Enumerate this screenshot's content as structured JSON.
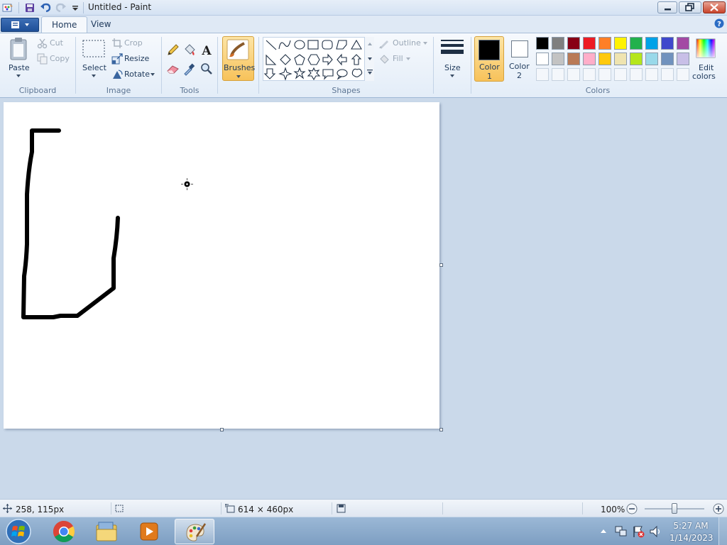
{
  "window": {
    "title": "Untitled - Paint"
  },
  "tabs": {
    "home": "Home",
    "view": "View"
  },
  "ribbon": {
    "clipboard": {
      "label": "Clipboard",
      "paste": "Paste",
      "cut": "Cut",
      "copy": "Copy"
    },
    "image": {
      "label": "Image",
      "select": "Select",
      "crop": "Crop",
      "resize": "Resize",
      "rotate": "Rotate"
    },
    "tools": {
      "label": "Tools"
    },
    "brushes": {
      "label": "Brushes"
    },
    "shapes": {
      "label": "Shapes",
      "outline": "Outline",
      "fill": "Fill"
    },
    "size": {
      "label": "Size"
    },
    "color1": {
      "label_line1": "Color",
      "label_line2": "1",
      "value": "#000000"
    },
    "color2": {
      "label_line1": "Color",
      "label_line2": "2",
      "value": "#ffffff"
    },
    "colors": {
      "label": "Colors",
      "edit_line1": "Edit",
      "edit_line2": "colors",
      "row1": [
        "#000000",
        "#7f7f7f",
        "#880015",
        "#ed1c24",
        "#ff7f27",
        "#fff200",
        "#22b14c",
        "#00a2e8",
        "#3f48cc",
        "#a349a4"
      ],
      "row2": [
        "#ffffff",
        "#c3c3c3",
        "#b97a57",
        "#ffaec9",
        "#ffc90e",
        "#efe4b0",
        "#b5e61d",
        "#99d9ea",
        "#7092be",
        "#c8bfe7"
      ]
    }
  },
  "status": {
    "cursor_position": "258, 115px",
    "canvas_size": "614 × 460px",
    "zoom": "100%"
  },
  "taskbar": {
    "time": "5:27 AM",
    "date": "1/14/2023"
  }
}
